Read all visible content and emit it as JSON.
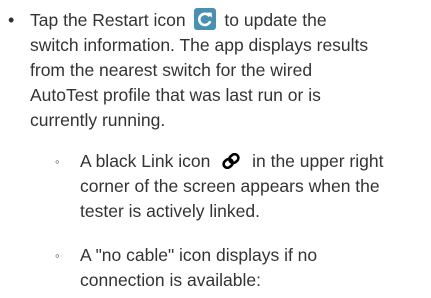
{
  "colors": {
    "text": "#333333",
    "restart_icon_bg": "#4a90b0",
    "restart_icon_glyph": "#ffffff",
    "link_icon": "#000000"
  },
  "icons": {
    "restart": "restart-icon",
    "link": "link-icon"
  },
  "bullet": {
    "line1_before_icon": "Tap the Restart icon",
    "line1_after_icon": "to update the",
    "line2": "switch information. The app displays results",
    "line3": "from the nearest switch for the wired",
    "line4": "AutoTest profile that was last run or is",
    "line5": "currently running."
  },
  "sub_bullets": [
    {
      "line1_before_icon": "A black Link icon",
      "line1_after_icon": "in the upper right",
      "line2": "corner of the screen appears when the",
      "line3": "tester is actively linked."
    },
    {
      "line1": "A \"no cable\" icon displays if no",
      "line2": "connection is available:"
    }
  ]
}
